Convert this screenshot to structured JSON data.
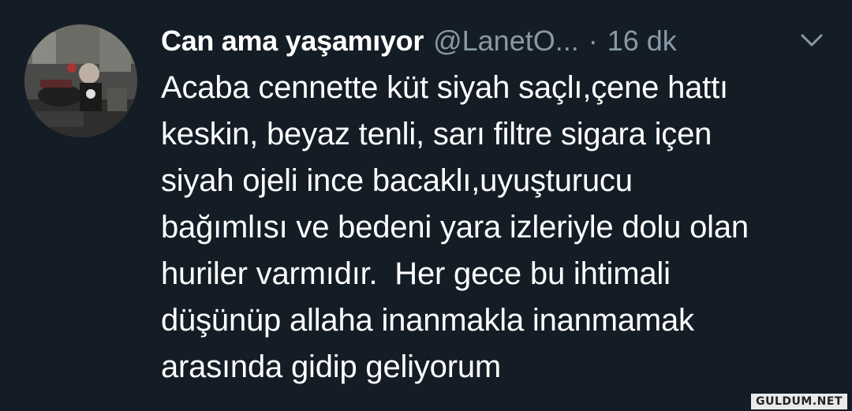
{
  "tweet": {
    "display_name": "Can ama yaşamıyor",
    "handle": "@LanetO...",
    "separator": "·",
    "time": "16 dk",
    "lines": [
      "Acaba cennette küt siyah saçlı,çene hattı",
      "keskin, beyaz tenli, sarı filtre sigara içen",
      "siyah ojeli ince bacaklı,uyuşturucu",
      "bağımlısı ve bedeni yara izleriyle dolu olan",
      "huriler varmıdır.  Her gece bu ihtimali",
      "düşünüp allaha inanmakla inanmamak",
      "arasında gidip geliyorum"
    ]
  },
  "icons": {
    "caret": "chevron-down-icon",
    "avatar": "avatar"
  },
  "colors": {
    "background": "#141d26",
    "text": "#ffffff",
    "secondary": "#8899a6"
  },
  "watermark": "GULDUM.NET"
}
